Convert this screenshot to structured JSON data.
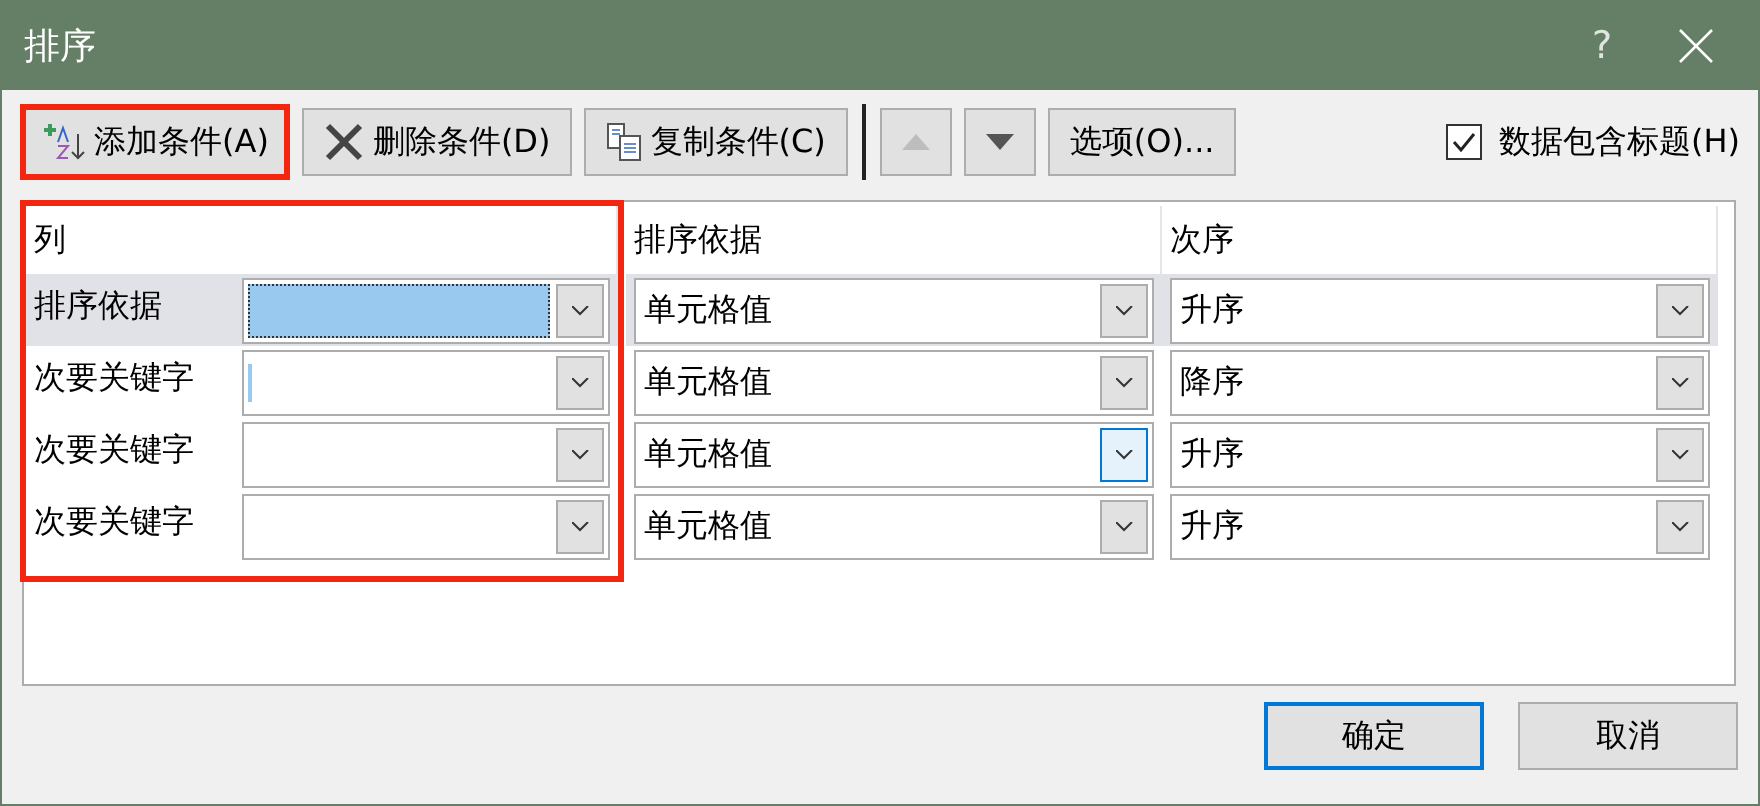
{
  "window": {
    "title": "排序",
    "help": "?"
  },
  "toolbar": [
    {
      "kind": "add",
      "label": "添加条件(A)",
      "highlighted": true,
      "disabled": false
    },
    {
      "kind": "delete",
      "label": "删除条件(D)",
      "highlighted": false,
      "disabled": false
    },
    {
      "kind": "copy",
      "label": "复制条件(C)",
      "highlighted": false,
      "disabled": false
    },
    {
      "kind": "up",
      "highlighted": false,
      "disabled": true
    },
    {
      "kind": "down",
      "highlighted": false,
      "disabled": false
    },
    {
      "kind": "options",
      "label": "选项(O)...",
      "highlighted": false,
      "disabled": false
    }
  ],
  "header_checkbox": {
    "label": "数据包含标题(H)",
    "checked": true
  },
  "grid": {
    "columns": [
      {
        "label": "列",
        "highlighted": true
      },
      {
        "label": "排序依据",
        "highlighted": false
      },
      {
        "label": "次序",
        "highlighted": false
      }
    ],
    "rows": [
      {
        "label": "排序依据",
        "selected": true,
        "sort_on": {
          "value": "单元格值",
          "hovered": false
        },
        "order": "升序"
      },
      {
        "label": "次要关键字",
        "selected": false,
        "sort_on": {
          "value": "单元格值",
          "hovered": false
        },
        "order": "降序"
      },
      {
        "label": "次要关键字",
        "selected": false,
        "sort_on": {
          "value": "单元格值",
          "hovered": true
        },
        "order": "升序"
      },
      {
        "label": "次要关键字",
        "selected": false,
        "sort_on": {
          "value": "单元格值",
          "hovered": false
        },
        "order": "升序"
      }
    ]
  },
  "buttons": [
    {
      "label": "确定",
      "default": true
    },
    {
      "label": "取消",
      "default": false
    }
  ]
}
